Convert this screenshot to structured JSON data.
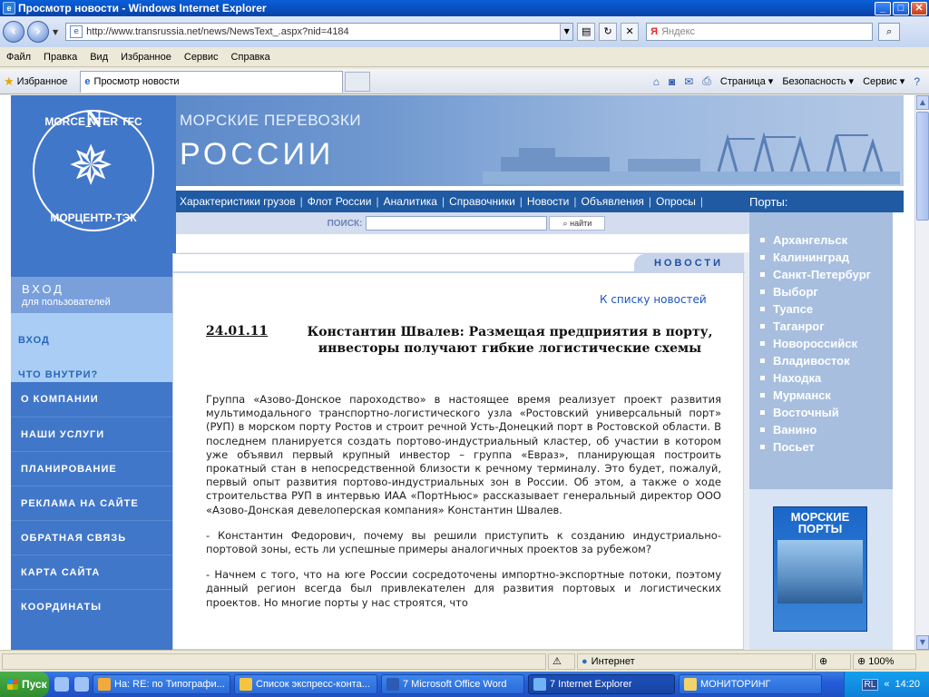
{
  "window": {
    "title": "Просмотр новости - Windows Internet Explorer",
    "minimize": "_",
    "maximize": "□",
    "close": "✕"
  },
  "address": {
    "url": "http://www.transrussia.net/news/NewsText_.aspx?nid=4184",
    "search_brand": "Я",
    "search_placeholder": "Яндекс"
  },
  "menu": [
    "Файл",
    "Правка",
    "Вид",
    "Избранное",
    "Сервис",
    "Справка"
  ],
  "favorites": {
    "label": "Избранное",
    "tab_label": "Просмотр новости",
    "commands": [
      "Страница ▾",
      "Безопасность ▾",
      "Сервис ▾"
    ]
  },
  "site": {
    "brand_line1": "МОРСКИЕ ПЕРЕВОЗКИ",
    "brand_line2": "РОССИИ",
    "logo_top": "MORCE NTER TFC",
    "logo_bottom": "МОРЦЕНТР-ТЭК",
    "logo_letter": "N",
    "top_nav": [
      "Характеристики грузов",
      "Флот России",
      "Аналитика",
      "Справочники",
      "Новости",
      "Объявления",
      "Опросы"
    ],
    "ports_label": "Порты:",
    "search_label": "ПОИСК:",
    "search_button": "найти",
    "login_title": "ВХОД",
    "login_subtitle": "для пользователей",
    "login_links": [
      "ВХОД",
      "ЧТО ВНУТРИ?"
    ],
    "left_menu": [
      "О КОМПАНИИ",
      "НАШИ УСЛУГИ",
      "ПЛАНИРОВАНИЕ",
      "РЕКЛАМА НА САЙТЕ",
      "ОБРАТНАЯ СВЯЗЬ",
      "КАРТА САЙТА",
      "КООРДИНАТЫ"
    ],
    "ports": [
      "Архангельск",
      "Калининград",
      "Санкт-Петербург",
      "Выборг",
      "Туапсе",
      "Таганрог",
      "Новороссийск",
      "Владивосток",
      "Находка",
      "Мурманск",
      "Восточный",
      "Ванино",
      "Посьет"
    ],
    "magazine_title": "МОРСКИЕ ПОРТЫ"
  },
  "news": {
    "section_tab": "НОВОСТИ",
    "back_link": "К списку новостей",
    "date": "24.01.11",
    "title": "Константин Швалев: Размещая предприятия в порту, инвесторы получают гибкие логистические схемы",
    "paragraphs": [
      "Группа «Азово-Донское пароходство» в настоящее время реализует проект развития мультимодального транспортно-логистического узла «Ростовский универсальный порт» (РУП) в морском порту Ростов и строит речной Усть-Донецкий порт в Ростовской области. В последнем планируется создать портово-индустриальный кластер, об участии в котором уже объявил первый крупный инвестор – группа «Евраз», планирующая построить прокатный стан в непосредственной близости к речному терминалу. Это будет, пожалуй, первый опыт развития портово-индустриальных зон в России. Об этом, а также о ходе строительства РУП в интервью ИАА «ПортНьюс» рассказывает генеральный директор ООО «Азово-Донская девелоперская компания» Константин Швалев.",
      "- Константин Федорович, почему вы решили приступить к созданию индустриально-портовой зоны, есть ли успешные примеры аналогичных проектов за рубежом?",
      "- Начнем с того, что на юге России сосредоточены импортно-экспортные потоки, поэтому данный регион всегда был привлекателен для развития портовых и логистических проектов. Но многие порты у нас строятся, что"
    ]
  },
  "status": {
    "zone": "Интернет",
    "zoom": "100%"
  },
  "taskbar": {
    "start": "Пуск",
    "items": [
      "На: RE: по Типографи...",
      "Список экспресс-конта...",
      "7 Microsoft Office Word",
      "7 Internet Explorer",
      "МОНИТОРИНГ"
    ],
    "lang": "RL",
    "time": "14:20"
  }
}
